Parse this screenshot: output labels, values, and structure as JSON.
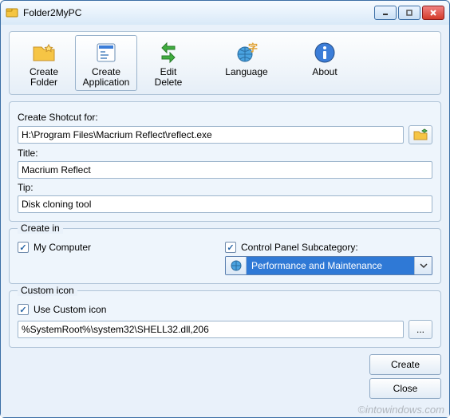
{
  "window": {
    "title": "Folder2MyPC"
  },
  "toolbar": {
    "createFolder1": "Create",
    "createFolder2": "Folder",
    "createApp1": "Create",
    "createApp2": "Application",
    "editDelete1": "Edit",
    "editDelete2": "Delete",
    "language": "Language",
    "about": "About"
  },
  "form": {
    "shortcutLabel": "Create Shotcut for:",
    "shortcutValue": "H:\\Program Files\\Macrium Reflect\\reflect.exe",
    "titleLabel": "Title:",
    "titleValue": "Macrium Reflect",
    "tipLabel": "Tip:",
    "tipValue": "Disk cloning tool"
  },
  "createIn": {
    "legend": "Create in",
    "myComputer": "My Computer",
    "controlPanel": "Control Panel Subcategory:",
    "selected": "Performance and Maintenance"
  },
  "customIcon": {
    "legend": "Custom icon",
    "useCustom": "Use Custom icon",
    "path": "%SystemRoot%\\system32\\SHELL32.dll,206",
    "dots": "..."
  },
  "buttons": {
    "create": "Create",
    "close": "Close"
  },
  "watermark": "©intowindows.com"
}
